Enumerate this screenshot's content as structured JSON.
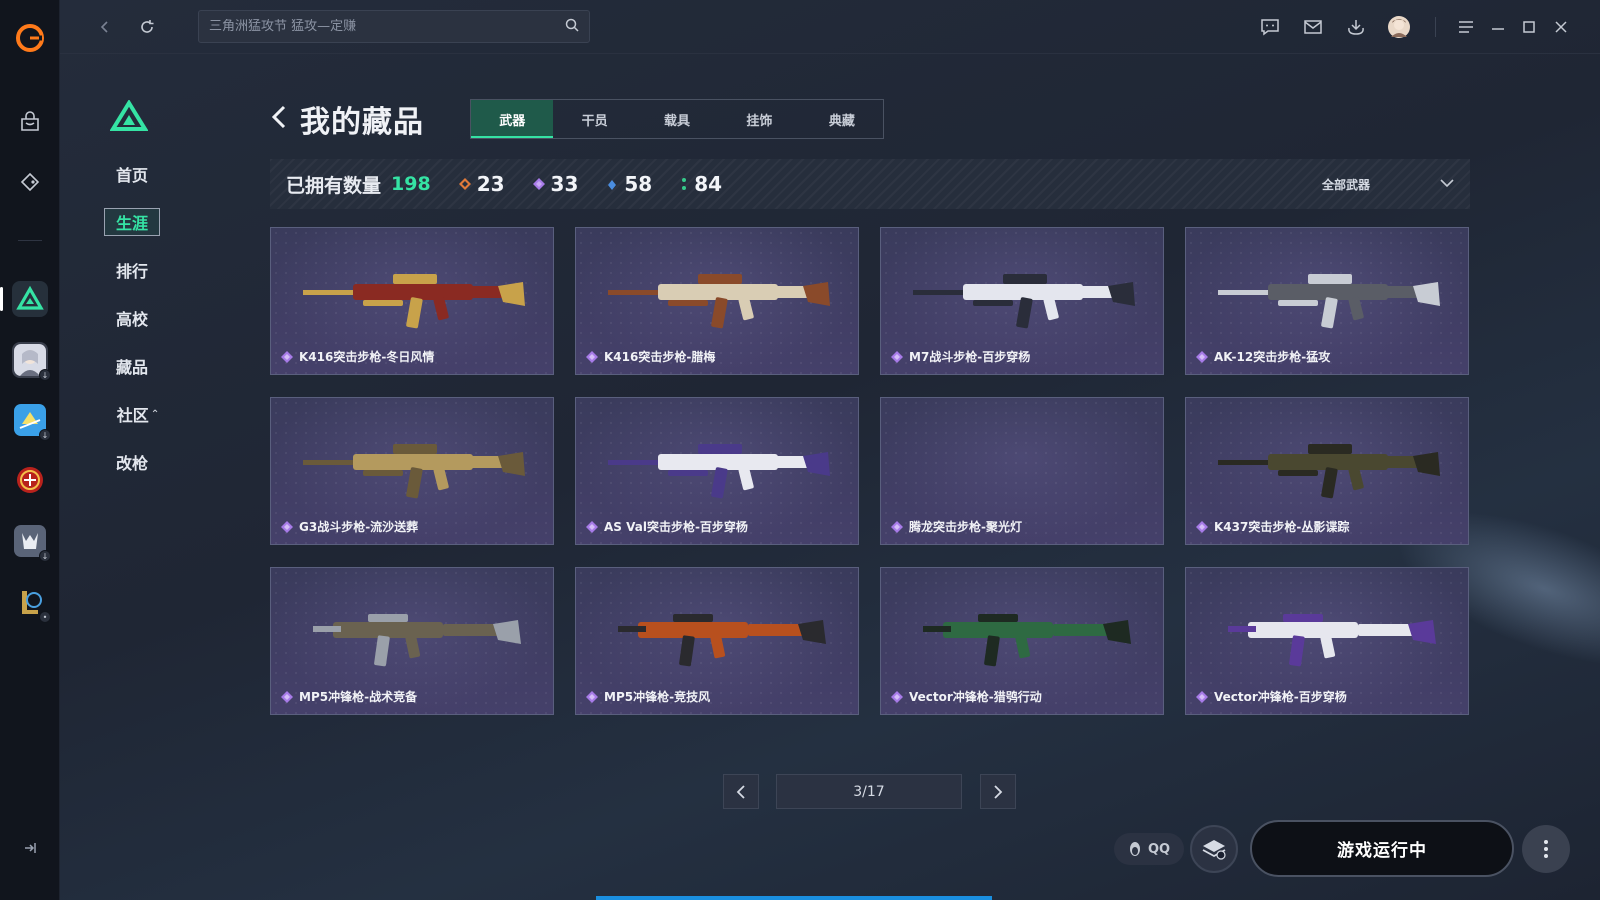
{
  "search": {
    "placeholder": "三角洲猛攻节 猛攻—定赚"
  },
  "subnav": {
    "items": [
      {
        "label": "首页"
      },
      {
        "label": "生涯",
        "active": true
      },
      {
        "label": "排行"
      },
      {
        "label": "高校"
      },
      {
        "label": "藏品"
      },
      {
        "label": "社区"
      },
      {
        "label": "改枪"
      }
    ]
  },
  "page": {
    "title": "我的藏品",
    "tabs": [
      {
        "label": "武器",
        "active": true
      },
      {
        "label": "干员"
      },
      {
        "label": "载具"
      },
      {
        "label": "挂饰"
      },
      {
        "label": "典藏"
      }
    ]
  },
  "stats": {
    "owned_label": "已拥有数量",
    "owned_count": "198",
    "rarities": [
      {
        "value": "23",
        "color": "#e07a3a"
      },
      {
        "value": "33",
        "color": "#a77be8"
      },
      {
        "value": "58",
        "color": "#4a8de0"
      },
      {
        "value": "84",
        "color": "#35c98a"
      }
    ],
    "filter_label": "全部武器"
  },
  "items": [
    {
      "name": "K416突击步枪-冬日风情",
      "icon": "rifle-icon",
      "body": "#8a2a22",
      "accent": "#c8a24a"
    },
    {
      "name": "K416突击步枪-腊梅",
      "icon": "rifle-icon",
      "body": "#d9cdb4",
      "accent": "#8a4a2a"
    },
    {
      "name": "M7战斗步枪-百步穿杨",
      "icon": "rifle-icon",
      "body": "#e4e6ee",
      "accent": "#2a2d3a"
    },
    {
      "name": "AK-12突击步枪-猛攻",
      "icon": "rifle-icon",
      "body": "#5a5d66",
      "accent": "#c8ccd4"
    },
    {
      "name": "G3战斗步枪-流沙送葬",
      "icon": "rifle-icon",
      "body": "#b49a5e",
      "accent": "#6a5a3a"
    },
    {
      "name": "AS Val突击步枪-百步穿杨",
      "icon": "rifle-icon",
      "body": "#e8e9f0",
      "accent": "#4a3a8a"
    },
    {
      "name": "腾龙突击步枪-聚光灯",
      "icon": "",
      "body": "",
      "accent": ""
    },
    {
      "name": "K437突击步枪-丛影谍踪",
      "icon": "rifle-icon",
      "body": "#4a4830",
      "accent": "#2a2a22"
    },
    {
      "name": "MP5冲锋枪-战术竞备",
      "icon": "smg-icon",
      "body": "#6a6250",
      "accent": "#9aa0aa"
    },
    {
      "name": "MP5冲锋枪-竞技风",
      "icon": "smg-icon",
      "body": "#b8501e",
      "accent": "#2a2a2e"
    },
    {
      "name": "Vector冲锋枪-猎鸮行动",
      "icon": "smg-icon",
      "body": "#2e6a42",
      "accent": "#1e2a22"
    },
    {
      "name": "Vector冲锋枪-百步穿杨",
      "icon": "smg-icon",
      "body": "#e6e7ee",
      "accent": "#5a3a9a"
    }
  ],
  "pagination": {
    "label": "3/17"
  },
  "bottom": {
    "qq_label": "QQ",
    "run_label": "游戏运行中"
  },
  "colors": {
    "accent": "#35e3a4"
  }
}
